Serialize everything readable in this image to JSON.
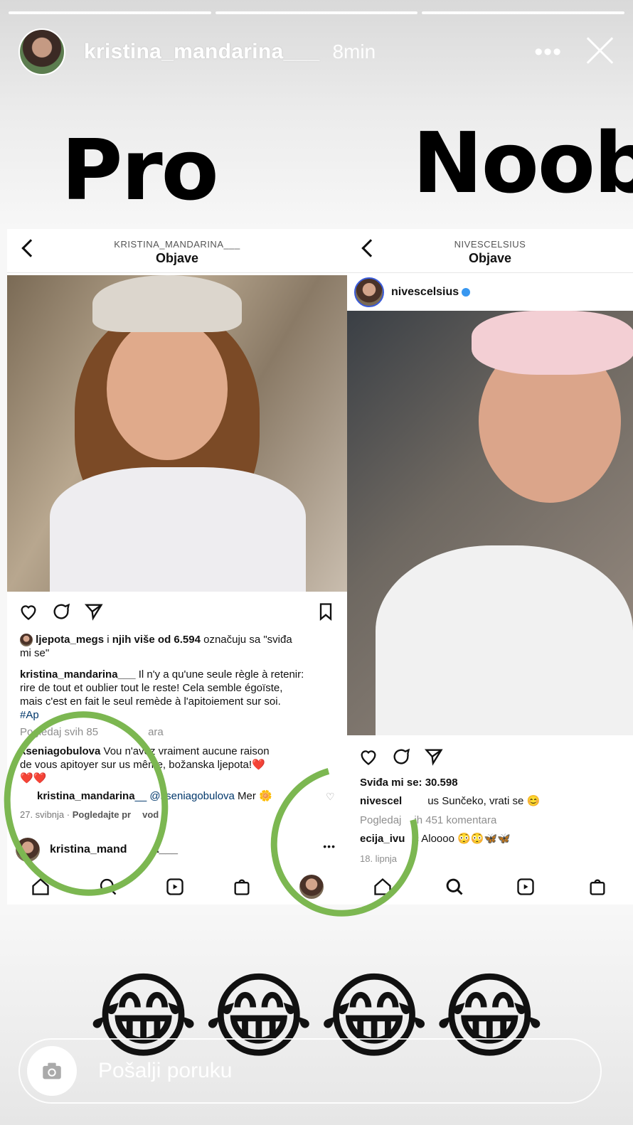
{
  "story": {
    "username": "kristina_mandarina___",
    "time": "8min",
    "more": "•••",
    "labels": {
      "left": "Pro",
      "right": "Noob"
    },
    "reply_placeholder": "Pošalji poruku",
    "emoji": [
      "😂",
      "😂",
      "😂",
      "😂"
    ]
  },
  "left_post": {
    "nav_subtitle": "KRISTINA_MANDARINA___",
    "nav_title": "Objave",
    "likes_user": "ljepota_megs",
    "likes_text_a": " i ",
    "likes_text_b": "njih više od 6.594",
    "likes_text_c": " označuju sa \"sviđa",
    "likes_text_d": "mi se\"",
    "caption_user": "kristina_mandarina___",
    "caption_1": " Il n'y a qu'une seule règle à retenir:",
    "caption_2": "rire de tout et oublier tout le reste! Cela semble égoïste,",
    "caption_3": "mais c'est en fait le seul remède à l'apitoiement sur soi.",
    "caption_4": "#Ap",
    "view_comments": "Pogledaj svih 85",
    "view_comments_tail": "ara",
    "comment_user": "kseniagobulova",
    "comment_1": " Vou",
    "comment_1b": "n'avez vraiment aucune raison",
    "comment_2": "de vous apitoyer sur",
    "comment_2b": "us même, božanska ljepota!❤️",
    "comment_3": "❤️❤️",
    "reply_user": "kristina_mandarina",
    "reply_mention": "__ @kseniagobulova",
    "reply_text": " Mer",
    "reply_emoji": "🌼",
    "date": "27. svibnja",
    "dot": "·",
    "translate": "Pogledajte pr",
    "translate_tail": "vod",
    "footer_user": "kristina_mand",
    "footer_user_tail": "a___",
    "footer_more": "•••"
  },
  "right_post": {
    "nav_subtitle": "NIVESCELSIUS",
    "nav_title": "Objave",
    "user": "nivescelsius",
    "likes": "Sviđa mi se: 30.598",
    "caption_user": "nivescel",
    "caption_user_tail": "us",
    "caption_text": " Sunčeko, vrati se 😊",
    "view_comments": "Pogledaj",
    "view_comments_tail": "ih 451 komentara",
    "comment_user": "ecija_ivu",
    "comment_text": "c Aloooo 😳😳🦋🦋",
    "date": "18. lipnja"
  }
}
